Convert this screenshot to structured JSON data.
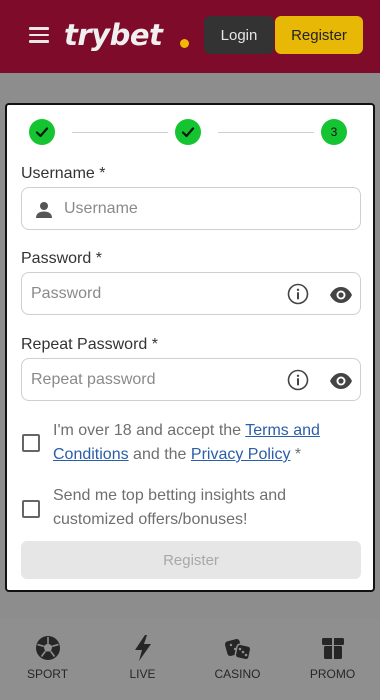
{
  "header": {
    "logo_text": "trybet",
    "login_label": "Login",
    "register_label": "Register"
  },
  "steps": {
    "current_step": "3"
  },
  "form": {
    "username_label": "Username *",
    "username_placeholder": "Username",
    "password_label": "Password *",
    "password_placeholder": "Password",
    "repeat_password_label": "Repeat Password *",
    "repeat_password_placeholder": "Repeat password",
    "terms_prefix": "I'm over 18 and accept the ",
    "terms_link": "Terms and Conditions",
    "terms_middle": " and the ",
    "privacy_link": "Privacy Policy",
    "terms_suffix": " *",
    "marketing_text": "Send me top betting insights and customized offers/bonuses!",
    "register_button": "Register"
  },
  "bottom_nav": {
    "items": [
      {
        "label": "SPORT",
        "icon": "soccer-ball-icon"
      },
      {
        "label": "LIVE",
        "icon": "lightning-icon"
      },
      {
        "label": "CASINO",
        "icon": "dice-icon"
      },
      {
        "label": "PROMO",
        "icon": "gift-icon"
      }
    ]
  },
  "colors": {
    "header_bg": "#c1123f",
    "register_accent": "#e8b806",
    "step_done": "#14c430",
    "link": "#2a5ea8"
  }
}
